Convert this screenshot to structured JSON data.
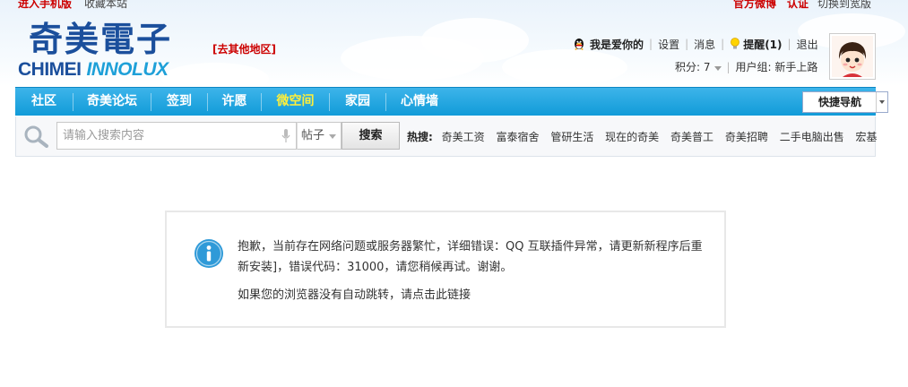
{
  "topbar": {
    "mobile_link": "进入手机版",
    "bookmark_link": "收藏本站",
    "weibo_link": "官方微博",
    "verify_link": "认证",
    "wide_link": "切换到宽版"
  },
  "logo": {
    "cn": "奇美電子",
    "en_main": "CHIMEI",
    "en_sub": "INNOLUX"
  },
  "region_link": "[去其他地区]",
  "user": {
    "name": "我是爱你的",
    "settings": "设置",
    "messages": "消息",
    "reminders": "提醒(1)",
    "logout": "退出",
    "points": "积分: 7",
    "group": "用户组: 新手上路"
  },
  "nav": {
    "items": [
      {
        "label": "社区"
      },
      {
        "label": "奇美论坛"
      },
      {
        "label": "签到"
      },
      {
        "label": "许愿"
      },
      {
        "label": "微空间"
      },
      {
        "label": "家园"
      },
      {
        "label": "心情墙"
      }
    ],
    "active_index": 4,
    "quick_nav": "快捷导航"
  },
  "search": {
    "placeholder": "请输入搜索内容",
    "type": "帖子",
    "button": "搜索",
    "hot_label": "热搜:",
    "hot_terms": [
      "奇美工资",
      "富泰宿舍",
      "管研生活",
      "现在的奇美",
      "奇美普工",
      "奇美招聘",
      "二手电脑出售",
      "宏基"
    ]
  },
  "message": {
    "text": "抱歉，当前存在网络问题或服务器繁忙，详细错误：QQ 互联插件异常，请更新新程序后重新安装]，错误代码：31000，请您稍候再试。谢谢。",
    "redirect_link": "如果您的浏览器没有自动跳转，请点击此链接"
  },
  "colors": {
    "nav_bg": "#119bd8",
    "active_nav": "#ffef3a",
    "brand_blue": "#1b4f9c",
    "alert_red": "#cc0000",
    "info_icon": "#2f9ad8"
  }
}
